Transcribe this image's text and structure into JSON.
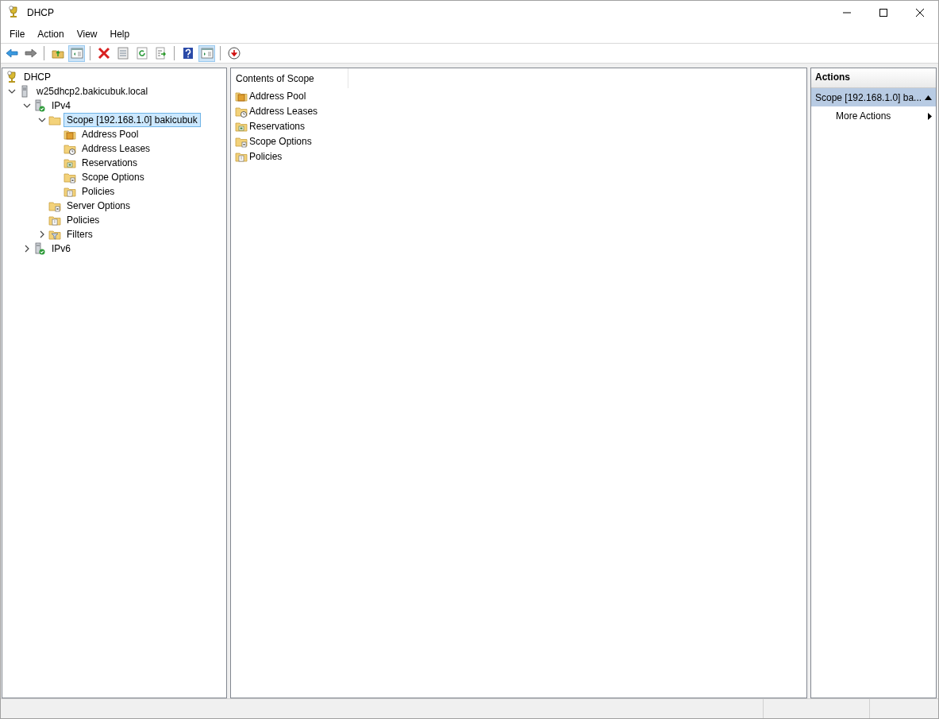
{
  "window": {
    "title": "DHCP"
  },
  "menu": [
    "File",
    "Action",
    "View",
    "Help"
  ],
  "toolbar": [
    {
      "kind": "back",
      "pressed": false
    },
    {
      "kind": "forward",
      "pressed": false
    },
    {
      "kind": "sep"
    },
    {
      "kind": "up",
      "pressed": false
    },
    {
      "kind": "tree",
      "pressed": true
    },
    {
      "kind": "sep"
    },
    {
      "kind": "delete",
      "pressed": false
    },
    {
      "kind": "properties",
      "pressed": false
    },
    {
      "kind": "refresh",
      "pressed": false
    },
    {
      "kind": "export",
      "pressed": false
    },
    {
      "kind": "sep"
    },
    {
      "kind": "help",
      "pressed": false
    },
    {
      "kind": "actionpane",
      "pressed": true
    },
    {
      "kind": "sep"
    },
    {
      "kind": "deactivate",
      "pressed": false
    }
  ],
  "tree": [
    {
      "label": "DHCP",
      "kind": "root",
      "selected": false,
      "children": [
        {
          "label": "w25dhcp2.bakicubuk.local",
          "kind": "server",
          "expanded": true,
          "selected": false,
          "children": [
            {
              "label": "IPv4",
              "kind": "ip",
              "expanded": true,
              "selected": false,
              "children": [
                {
                  "label": "Scope [192.168.1.0] bakicubuk",
                  "kind": "scope",
                  "expanded": true,
                  "selected": true,
                  "children": [
                    {
                      "label": "Address Pool",
                      "kind": "pool",
                      "selected": false
                    },
                    {
                      "label": "Address Leases",
                      "kind": "leases",
                      "selected": false
                    },
                    {
                      "label": "Reservations",
                      "kind": "reservations",
                      "selected": false
                    },
                    {
                      "label": "Scope Options",
                      "kind": "options",
                      "selected": false
                    },
                    {
                      "label": "Policies",
                      "kind": "policies",
                      "selected": false
                    }
                  ]
                },
                {
                  "label": "Server Options",
                  "kind": "options",
                  "selected": false
                },
                {
                  "label": "Policies",
                  "kind": "policies",
                  "selected": false
                },
                {
                  "label": "Filters",
                  "kind": "filters",
                  "expanded": false,
                  "selected": false
                }
              ]
            },
            {
              "label": "IPv6",
              "kind": "ip",
              "expanded": false,
              "selected": false
            }
          ]
        }
      ]
    }
  ],
  "contents": {
    "header": "Contents of Scope",
    "items": [
      {
        "label": "Address Pool",
        "kind": "pool"
      },
      {
        "label": "Address Leases",
        "kind": "leases"
      },
      {
        "label": "Reservations",
        "kind": "reservations"
      },
      {
        "label": "Scope Options",
        "kind": "options"
      },
      {
        "label": "Policies",
        "kind": "policies"
      }
    ]
  },
  "actions": {
    "header": "Actions",
    "section": "Scope [192.168.1.0] ba...",
    "items": [
      "More Actions"
    ]
  }
}
